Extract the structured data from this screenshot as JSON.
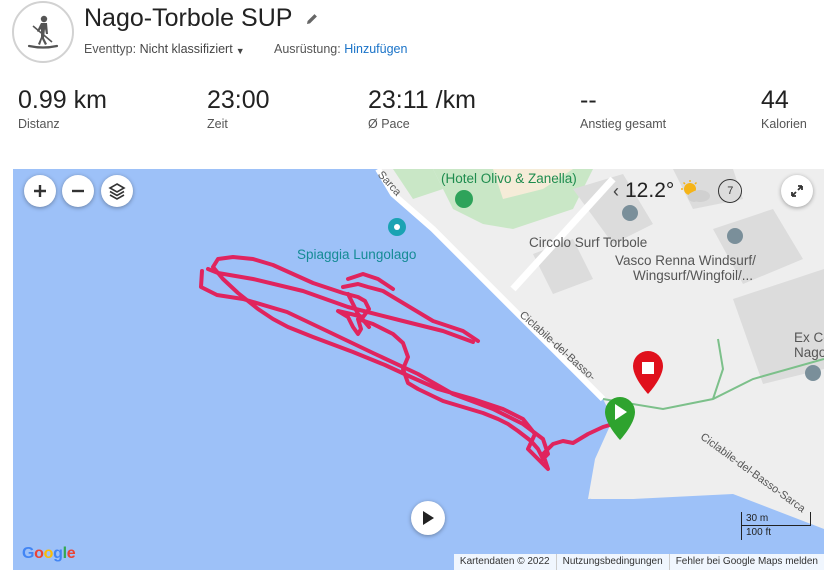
{
  "activity": {
    "title": "Nago-Torbole SUP",
    "icon": "paddleboard-icon",
    "event_type_label": "Eventtyp:",
    "event_type_value": "Nicht klassifiziert",
    "gear_label": "Ausrüstung:",
    "gear_link": "Hinzufügen"
  },
  "stats": [
    {
      "value": "0.99 km",
      "label": "Distanz"
    },
    {
      "value": "23:00",
      "label": "Zeit"
    },
    {
      "value": "23:11 /km",
      "label": "Ø Pace"
    },
    {
      "value": "--",
      "label": "Anstieg gesamt"
    },
    {
      "value": "44",
      "label": "Kalorien"
    }
  ],
  "map": {
    "pois": {
      "hotel": "(Hotel Olivo & Zanella)",
      "beach": "Spiaggia Lungolago",
      "surf_club": "Circolo Surf Torbole",
      "vasco_1": "Vasco Renna Windsurf/",
      "vasco_2": "Wingsurf/Wingfoil/...",
      "ex_1": "Ex Co",
      "ex_2": "Nago"
    },
    "roads": {
      "sarca": "Sarca",
      "ciclabile_1": "Ciclabile-del-Basso-",
      "ciclabile_2": "Ciclabile-del-Basso-Sarca"
    },
    "weather": {
      "temperature": "12.2°",
      "icon": "partly-cloudy-icon",
      "badge": "7"
    },
    "scale": {
      "metric": "30 m",
      "imperial": "100 ft"
    },
    "attribution": [
      "Kartendaten © 2022",
      "Nutzungsbedingungen",
      "Fehler bei Google Maps melden"
    ],
    "google_logo": "Google",
    "colors": {
      "water": "#9dc1f8",
      "land": "#eeeeee",
      "track": "#e0245e",
      "start": "#2ea32e",
      "end": "#e0101c",
      "park": "#c9e7c6"
    }
  }
}
